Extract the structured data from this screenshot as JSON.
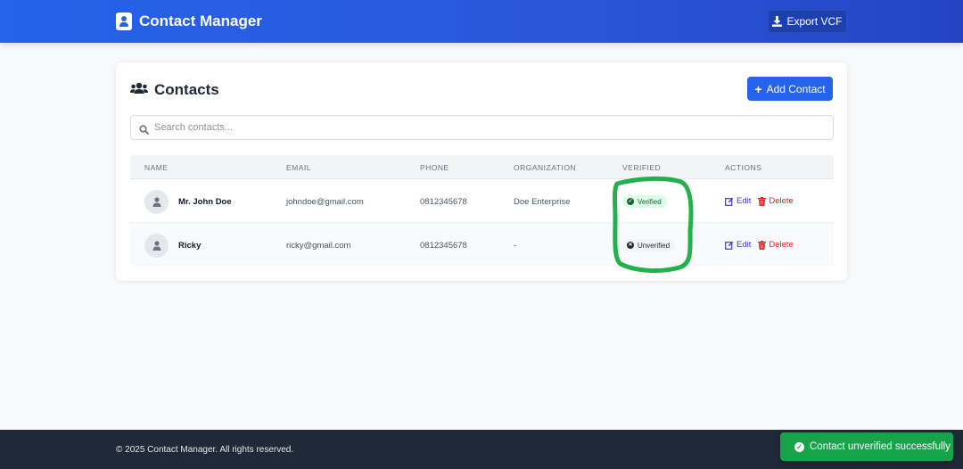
{
  "app": {
    "title": "Contact Manager",
    "export_label": "Export VCF"
  },
  "card": {
    "title": "Contacts",
    "add_label": "Add Contact",
    "search_placeholder": "Search contacts..."
  },
  "table": {
    "columns": [
      "NAME",
      "EMAIL",
      "PHONE",
      "ORGANIZATION",
      "VERIFIED",
      "ACTIONS"
    ],
    "rows": [
      {
        "name": "Mr. John Doe",
        "email": "johndoe@gmail.com",
        "phone": "0812345678",
        "organization": "Doe Enterprise",
        "status": "Verified",
        "edit": "Edit",
        "delete": "Delete"
      },
      {
        "name": "Ricky",
        "email": "ricky@gmail.com",
        "phone": "0812345678",
        "organization": "-",
        "status": "Unverified",
        "edit": "Edit",
        "delete": "Delete"
      }
    ]
  },
  "footer": {
    "copyright": "© 2025 Contact Manager. All rights reserved."
  },
  "toast": {
    "message": "Contact unverified successfully"
  },
  "colors": {
    "primary": "#2563eb",
    "success": "#16a34a",
    "danger": "#dc2626",
    "annotation": "#22b14c",
    "footer": "#1f2937"
  }
}
